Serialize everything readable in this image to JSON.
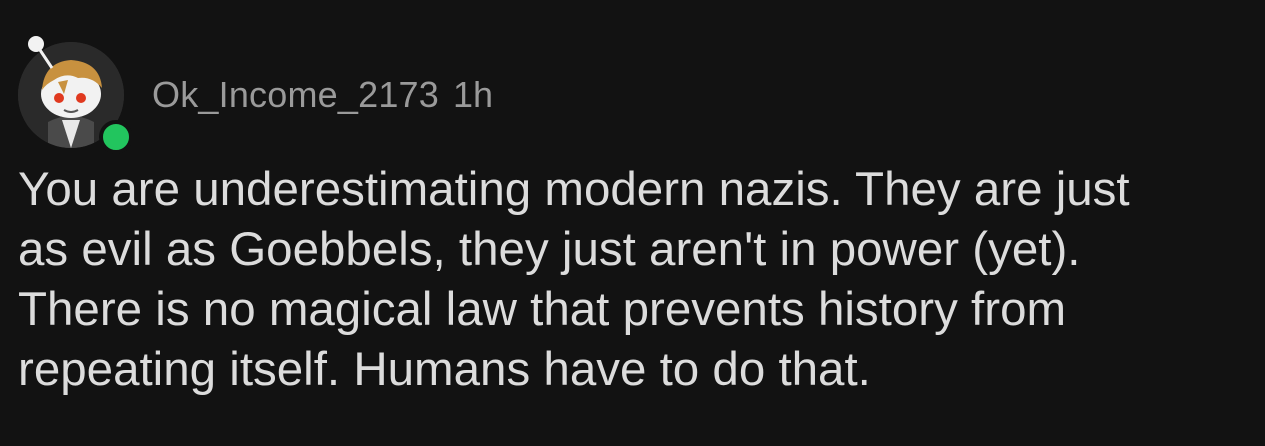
{
  "comment": {
    "author": "Ok_Income_2173",
    "time": "1h",
    "status_color": "#22c55e",
    "avatar": "snoo-avatar",
    "body_lines": [
      "You are underestimating modern nazis. They are just",
      "as evil as Goebbels, they just aren't in power (yet).",
      "There is no magical law that prevents history from",
      "repeating itself. Humans have to do that."
    ]
  }
}
